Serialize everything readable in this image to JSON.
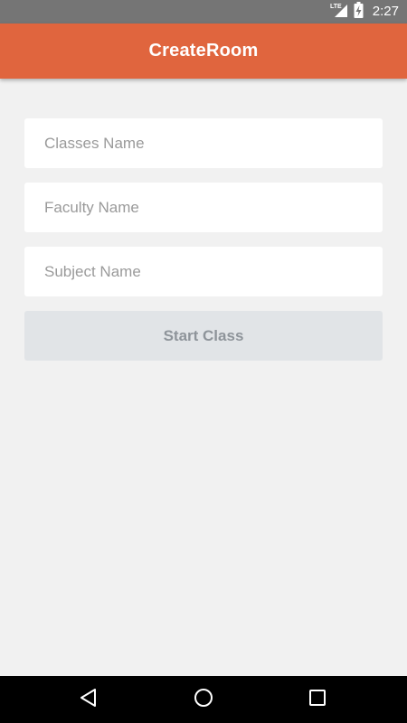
{
  "status_bar": {
    "network": "LTE",
    "time": "2:27",
    "icons": [
      "lte-signal-icon",
      "battery-charging-icon"
    ]
  },
  "app_bar": {
    "title": "CreateRoom"
  },
  "form": {
    "class_name": {
      "value": "",
      "placeholder": "Classes Name"
    },
    "faculty_name": {
      "value": "",
      "placeholder": "Faculty Name"
    },
    "subject_name": {
      "value": "",
      "placeholder": "Subject Name"
    },
    "start_button_label": "Start Class"
  },
  "nav_bar": {
    "icons": [
      "back-icon",
      "home-icon",
      "recents-icon"
    ]
  },
  "colors": {
    "app_bar": "#e0653e",
    "status_bar": "#757575",
    "background": "#f1f1f1",
    "button_disabled_bg": "#e1e4e7",
    "button_disabled_text": "#8e949a"
  }
}
